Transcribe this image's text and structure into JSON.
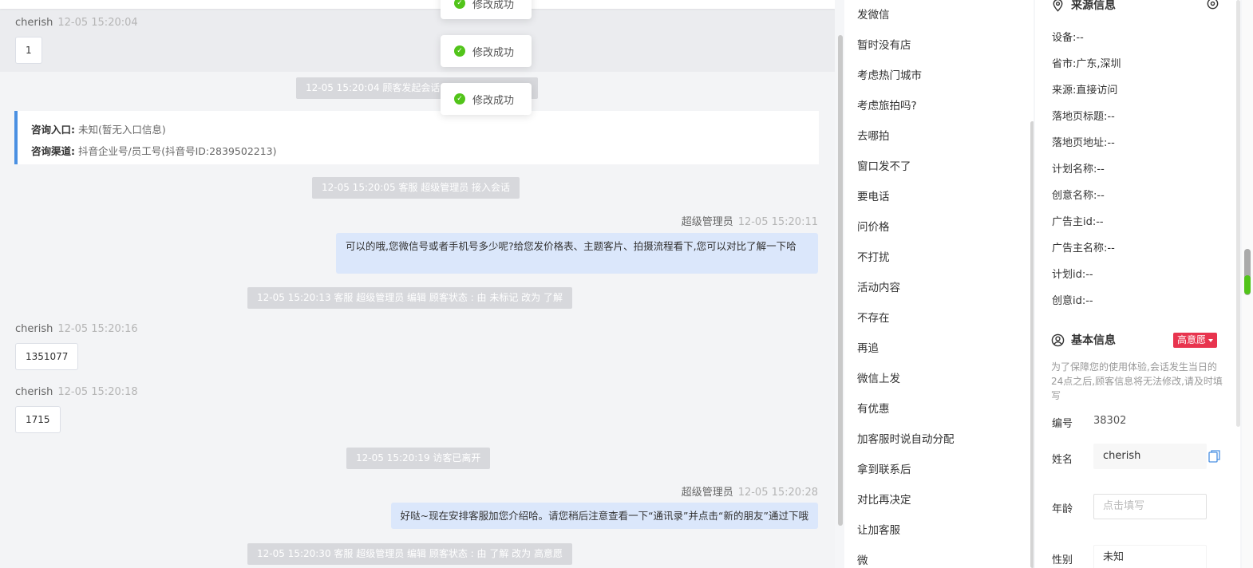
{
  "toasts": [
    "修改成功",
    "修改成功",
    "修改成功"
  ],
  "chat": {
    "consult": {
      "entry_label": "咨询入口:",
      "entry_value": "未知(暂无入口信息)",
      "channel_label": "咨询渠道:",
      "channel_value": "抖音企业号/员工号(抖音号ID:2839502213)"
    },
    "messages": [
      {
        "sender": "cherish",
        "time": "12-05 15:20:04",
        "text": "1"
      },
      {
        "system": "12-05 15:20:04 顾客发起会话,"
      },
      {
        "system": "12-05 15:20:05 客服 超级管理员 接入会话"
      },
      {
        "sender": "超级管理员",
        "time": "12-05 15:20:11",
        "text": "可以的哦,您微信号或者手机号多少呢?给您发价格表、主题客片、拍摄流程看下,您可以对比了解一下哈"
      },
      {
        "system": "12-05 15:20:13 客服 超级管理员 编辑 顾客状态 : 由 未标记 改为 了解"
      },
      {
        "sender": "cherish",
        "time": "12-05 15:20:16",
        "text": "1351077"
      },
      {
        "sender": "cherish",
        "time": "12-05 15:20:18",
        "text": "1715"
      },
      {
        "system": "12-05 15:20:19 访客已离开"
      },
      {
        "sender": "超级管理员",
        "time": "12-05 15:20:28",
        "text": "好哒~现在安排客服加您介绍哈。请您稍后注意查看一下“通讯录”并点击“新的朋友”通过下哦"
      },
      {
        "system": "12-05 15:20:30 客服 超级管理员 编辑 顾客状态 : 由 了解 改为 高意愿"
      }
    ]
  },
  "quick_replies": [
    "发微信",
    "暂时没有店",
    "考虑热门城市",
    "考虑旅拍吗?",
    "去哪拍",
    "窗口发不了",
    "要电话",
    "问价格",
    "不打扰",
    "活动内容",
    "不存在",
    "再追",
    "微信上发",
    "有优惠",
    "加客服时说自动分配",
    "拿到联系后",
    "对比再决定",
    "让加客服",
    "微"
  ],
  "info": {
    "source_title": "来源信息",
    "source_rows": [
      "设备:--",
      "省市:广东,深圳",
      "来源:直接访问",
      "落地页标题:--",
      "落地页地址:--",
      "计划名称:--",
      "创意名称:--",
      "广告主id:--",
      "广告主名称:--",
      "计划id:--",
      "创意id:--"
    ],
    "basic_title": "基本信息",
    "intent_badge": "高意愿",
    "tip": "为了保障您的使用体验,会话发生当日的24点之后,顾客信息将无法修改,请及时填写",
    "id_label": "编号",
    "id_value": "38302",
    "name_label": "姓名",
    "name_value": "cherish",
    "age_label": "年龄",
    "age_placeholder": "点击填写",
    "gender_label": "性别",
    "gender_value": "未知"
  },
  "colors": {
    "accent": "#4a90e2",
    "badge": "#e8344e",
    "success": "#52c41a",
    "out_bubble": "#dbe7fb"
  },
  "icons": [
    "check-circle-icon",
    "location-pin-icon",
    "settings-icon",
    "user-circle-icon",
    "copy-icon",
    "caret-down-icon"
  ]
}
